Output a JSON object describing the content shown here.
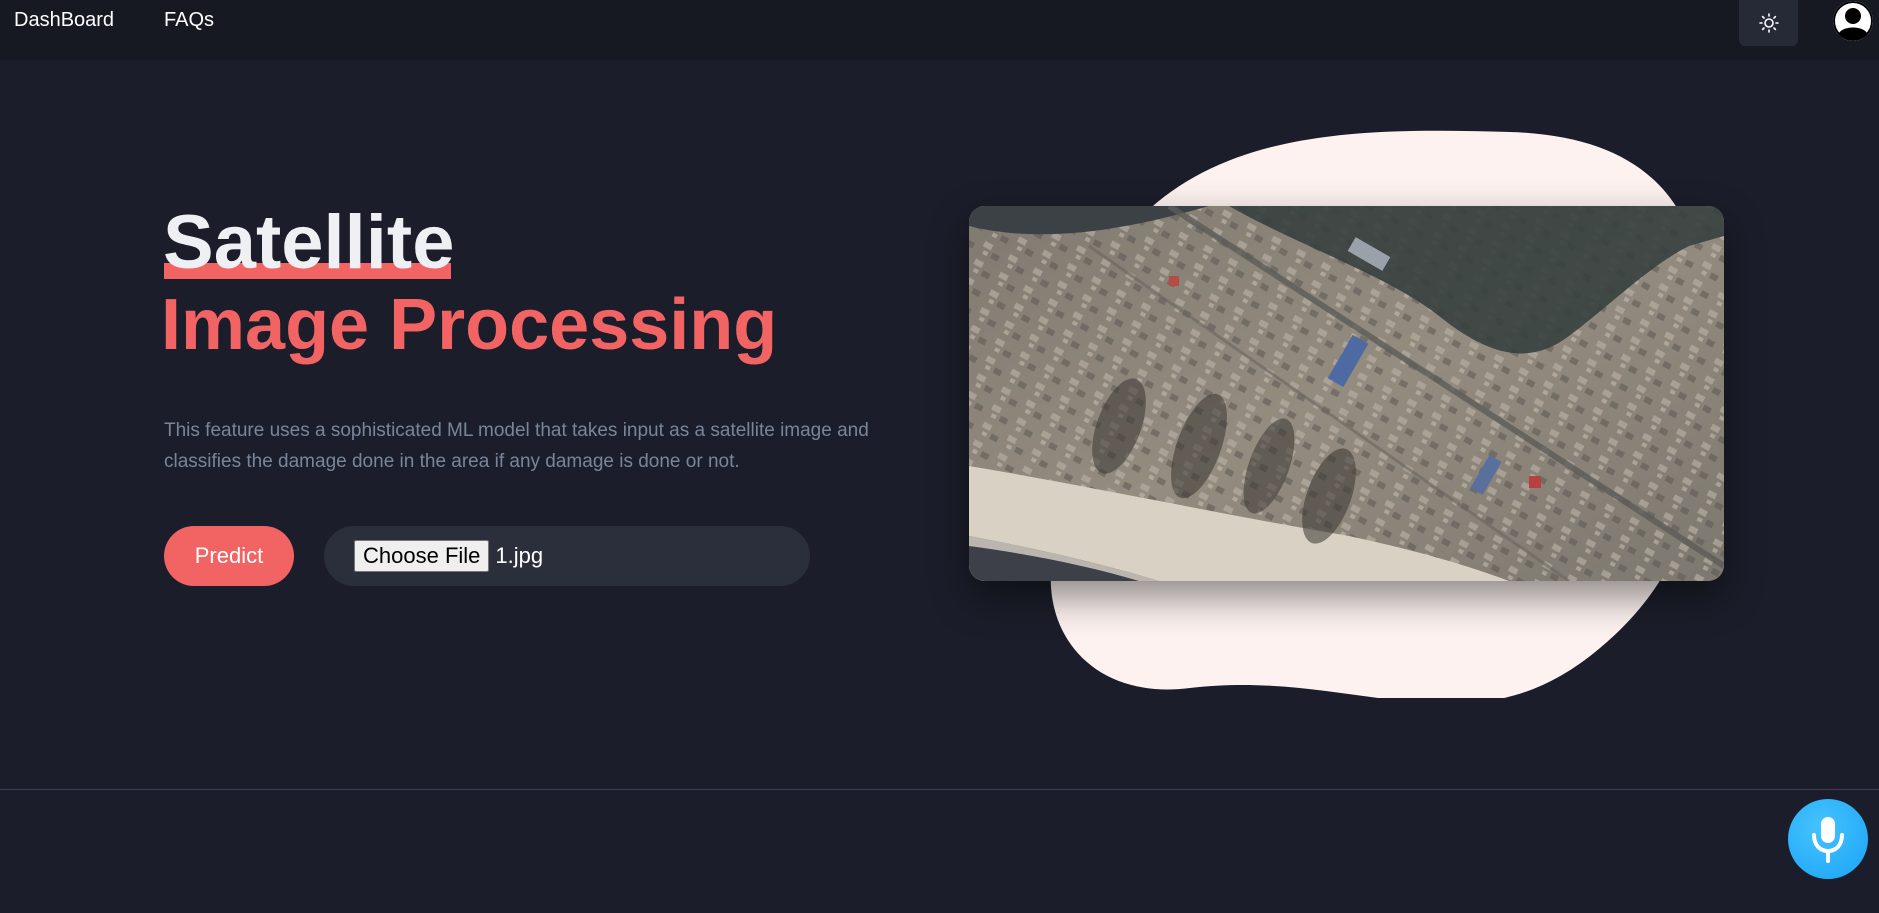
{
  "nav": {
    "dashboard_label": "DashBoard",
    "faqs_label": "FAQs"
  },
  "header": {
    "theme_toggle_icon": "sun-icon",
    "avatar_icon": "user-icon"
  },
  "hero": {
    "title_line1": "Satellite",
    "title_line2": "Image Processing",
    "description": "This feature uses a sophisticated ML model that takes input as a satellite image and classifies the damage done in the area if any damage is done or not.",
    "predict_label": "Predict",
    "choose_file_label": "Choose File",
    "file_name": "1.jpg",
    "image_subject": "satellite-aerial-photo"
  },
  "assistant": {
    "mic_icon": "microphone-icon"
  },
  "colors": {
    "background": "#1b1e2a",
    "topbar": "#171922",
    "accent": "#f26464",
    "blob": "#fdf2f0",
    "mic": "#1aa3f5"
  }
}
